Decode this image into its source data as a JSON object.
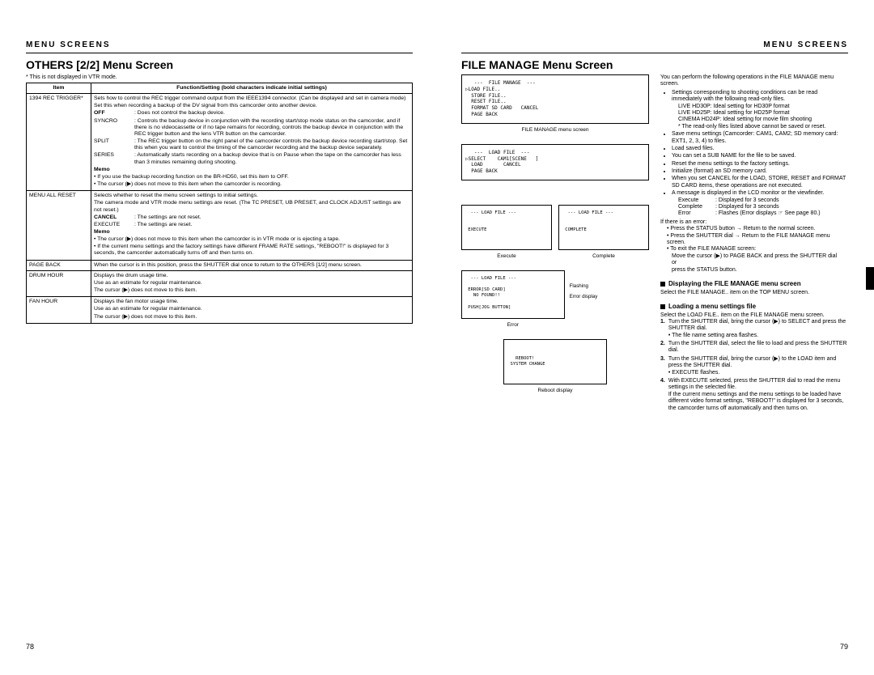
{
  "left": {
    "header": "MENU SCREENS",
    "title": "OTHERS [2/2] Menu Screen",
    "note": "* This is not displayed in VTR mode.",
    "thItem": "Item",
    "thFunc": "Function/Setting (bold characters indicate initial settings)",
    "r1Item": "1394 REC TRIGGER*",
    "r1a": "Sets how to control the REC trigger command output from the IEEE1394 connector. (Can be displayed and set in camera mode)",
    "r1b": "Set this when recording a backup of the DV signal from this camcorder onto another device.",
    "r1off": "OFF",
    "r1offD": ": Does not control the backup device.",
    "r1sync": "SYNCRO",
    "r1syncD": ": Controls the backup device in conjunction with the recording start/stop mode status on the camcorder, and if there is no videocassette or if no tape remains for recording, controls the backup device in conjunction with the REC trigger button and the lens VTR button on the camcorder.",
    "r1split": "SPLIT",
    "r1splitD": ": The REC trigger button on the right panel of the camcorder controls the backup device recording start/stop. Set this when you want to control the timing of the camcorder recording and the backup device separately.",
    "r1series": "SERIES",
    "r1seriesD": ": Automatically starts recording on a backup device that is on Pause when the tape on the camcorder has less than 3 minutes remaining during shooting.",
    "r1memo": "Memo",
    "r1m1": "• If you use the backup recording function on the BR-HD50, set this item to OFF.",
    "r1m2": "• The cursor (▶) does not move to this item when the camcorder is recording.",
    "r2Item": "MENU ALL RESET",
    "r2a": "Selects whether to reset the menu screen settings to initial settings.",
    "r2b": "The camera mode and VTR mode menu settings are reset. (The TC PRESET, UB PRESET, and CLOCK ADJUST settings are not reset.)",
    "r2cancel": "CANCEL",
    "r2cancelD": ": The settings are not reset.",
    "r2exec": "EXECUTE",
    "r2execD": ": The settings are reset.",
    "r2memo": "Memo",
    "r2m1": "• The cursor (▶) does not move to this item when the camcorder is in VTR mode or is ejecting a tape.",
    "r2m2": "• If the current menu settings and the factory settings have different FRAME RATE settings, \"REBOOT!\" is displayed for 3 seconds, the camcorder automatically turns off and then turns on.",
    "r3Item": "PAGE BACK",
    "r3a": "When the cursor is in this position, press the SHUTTER dial once to return to the OTHERS [1/2] menu screen.",
    "r4Item": "DRUM HOUR",
    "r4a": "Displays the drum usage time.",
    "r4b": "Use as an estimate for regular maintenance.",
    "r4c": "The cursor (▶) does not move to this item.",
    "r5Item": "FAN HOUR",
    "r5a": "Displays the fan motor usage time.",
    "r5b": "Use as an estimate for regular maintenance.",
    "r5c": "The cursor (▶) does not move to this item.",
    "pageNum": "78"
  },
  "right": {
    "header": "MENU SCREENS",
    "title": "FILE MANAGE Menu Screen",
    "lcd1": "   ---  FILE MANAGE  ---\n▷LOAD FILE..\n  STORE FILE..\n  RESET FILE..\n  FORMAT SD CARD   CANCEL\n  PAGE BACK",
    "lcd1cap": "FILE MANAGE menu screen",
    "lcd2": "   ---  LOAD FILE  ---\n▷SELECT    CAM1[SCENE   ]\n  LOAD       CANCEL\n  PAGE BACK",
    "lcd3a": "  --- LOAD FILE ---\n\n\n EXECUTE",
    "lcd3aCap": "Execute",
    "lcd3b": "  --- LOAD FILE ---\n\n\n COMPLETE",
    "lcd3bCap": "Complete",
    "lcd4": "  --- LOAD FILE ---\n\n ERROR[SD CARD]\n   NO FOUND!!\n\n PUSH[JOG BUTTON]",
    "lcd4cap": "Error",
    "lcd4a1": "Flashing",
    "lcd4a2": "Error display",
    "lcd5": "\n\n   REBOOT!\n SYSTEM CHANGE",
    "lcd5cap": "Reboot display",
    "p1": "You can perform the following operations in the FILE MANAGE menu screen.",
    "b1": "Settings corresponding to shooting conditions can be read immediately with the following read-only files.",
    "b1a": "LIVE HD30P: Ideal setting for HD30P format",
    "b1b": "LIVE HD25P: Ideal setting for HD25P format",
    "b1c": "CINEMA HD24P: Ideal setting for movie film shooting",
    "b1d": "* The read-only files listed above cannot be saved or reset.",
    "b2": "Save menu settings (Camcorder: CAM1, CAM2; SD memory card: EXT1, 2, 3, 4) to files.",
    "b3": "Load saved files.",
    "b4": "You can set a SUB NAME for the file to be saved.",
    "b5": "Reset the menu settings to the factory settings.",
    "b6": "Initialize (format) an SD memory card.",
    "b7": "When you set CANCEL for the LOAD, STORE, RESET and FORMAT SD CARD items, these operations are not executed.",
    "b8": "A message is displayed in the LCD monitor or the viewfinder.",
    "b8a": "Execute",
    "b8aD": ": Displayed for 3 seconds",
    "b8b": "Complete",
    "b8bD": ": Displayed for 3 seconds",
    "b8c": "Error",
    "b8cD": ": Flashes (Error displays ☞ See page 80.)",
    "err": "If there is an error:",
    "err1": "• Press the STATUS button → Return to the normal screen.",
    "err2": "• Press the SHUTTER dial → Return to the FILE MANAGE menu screen.",
    "err3": "• To exit the FILE MANAGE screen:",
    "err3a": "Move the cursor (▶) to PAGE BACK and press the SHUTTER dial",
    "err3b": "or",
    "err3c": "press the STATUS button.",
    "sh1": "Displaying the FILE MANAGE menu screen",
    "sh1t": "Select the FILE MANAGE.. item on the TOP MENU screen.",
    "sh2": "Loading a menu settings file",
    "sh2t": "Select the LOAD FILE.. item on the FILE MANAGE menu screen.",
    "ol1": "Turn the SHUTTER dial, bring the cursor (▶) to SELECT and press the SHUTTER dial.",
    "ol1a": "• The file name setting area flashes.",
    "ol2": "Turn the SHUTTER dial, select the file to load and press the SHUTTER dial.",
    "ol3": "Turn the SHUTTER dial, bring the cursor (▶) to the LOAD item and press the SHUTTER dial.",
    "ol3a": "• EXECUTE flashes.",
    "ol4": "With EXECUTE selected, press the SHUTTER dial to read the menu settings in the selected file.",
    "ol4a": "If the current menu settings and the menu settings to be loaded have different video format settings, \"REBOOT!\" is displayed for 3 seconds, the camcorder turns off automatically and then turns on.",
    "pageNum": "79"
  }
}
